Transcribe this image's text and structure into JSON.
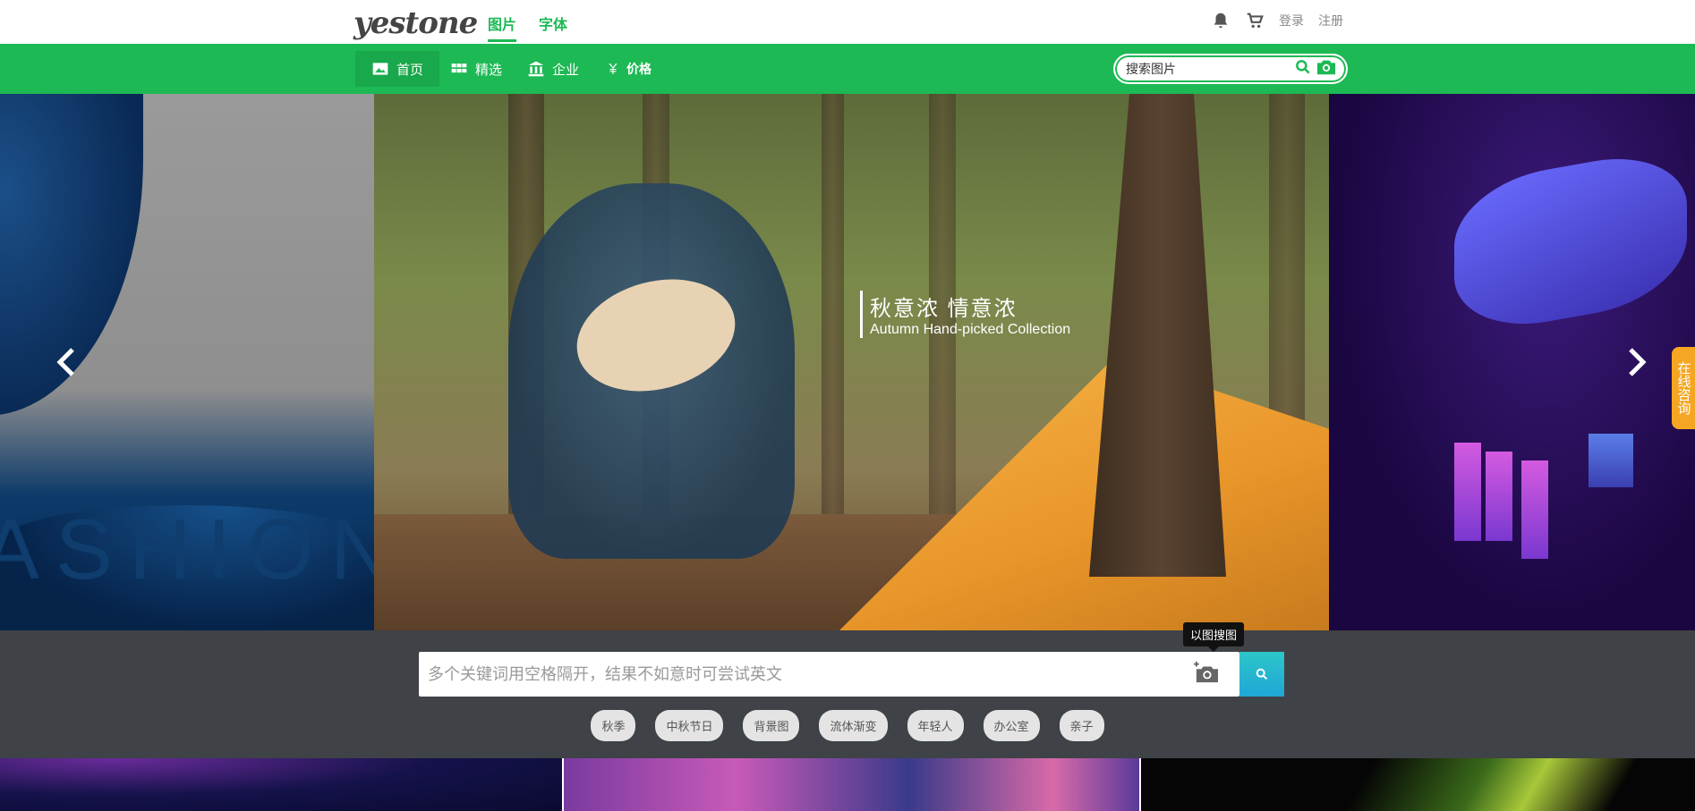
{
  "brand": {
    "logo_text": "yestone"
  },
  "top_tabs": [
    {
      "label": "图片"
    },
    {
      "label": "字体"
    }
  ],
  "top_right": {
    "login": "登录",
    "register": "注册",
    "icons": [
      "bell-icon",
      "cart-icon"
    ]
  },
  "nav": {
    "items": [
      {
        "label": "首页",
        "icon": "image-icon"
      },
      {
        "label": "精选",
        "icon": "grid-icon"
      },
      {
        "label": "企业",
        "icon": "bank-icon"
      },
      {
        "label": "价格",
        "icon": "yuan-icon"
      }
    ],
    "search_placeholder": "搜索图片"
  },
  "carousel": {
    "left_text": "ASHION",
    "slogan_cn": "秋意浓 情意浓",
    "slogan_en": "Autumn Hand-picked Collection"
  },
  "consult": {
    "label": "在线咨询"
  },
  "search": {
    "placeholder": "多个关键词用空格隔开，结果不如意时可尝试英文",
    "tooltip": "以图搜图"
  },
  "tags": [
    "秋季",
    "中秋节日",
    "背景图",
    "流体渐变",
    "年轻人",
    "办公室",
    "亲子"
  ],
  "colors": {
    "brand_green": "#1db954",
    "search_btn": "#25b6d0",
    "consult_orange": "#f5a623",
    "band_gray": "#3f4246"
  }
}
